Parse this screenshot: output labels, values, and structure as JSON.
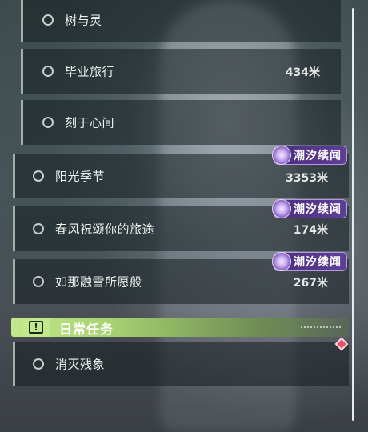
{
  "quests": [
    {
      "label": "树与灵",
      "distance": "",
      "badge": ""
    },
    {
      "label": "毕业旅行",
      "distance": "434米",
      "badge": ""
    },
    {
      "label": "刻于心间",
      "distance": "",
      "badge": ""
    },
    {
      "label": "阳光季节",
      "distance": "3353米",
      "badge": "潮汐续闻"
    },
    {
      "label": "春风祝颂你的旅途",
      "distance": "174米",
      "badge": "潮汐续闻"
    },
    {
      "label": "如那融雪所愿般",
      "distance": "267米",
      "badge": "潮汐续闻"
    }
  ],
  "daily_section": {
    "title": "日常任务",
    "icon": "exclamation-icon",
    "accent_color": "#c2e88c"
  },
  "daily_quests": [
    {
      "label": "消灭残象"
    }
  ],
  "badge_color": "#5d3f97",
  "tracked_marker_color": "#e8506a"
}
